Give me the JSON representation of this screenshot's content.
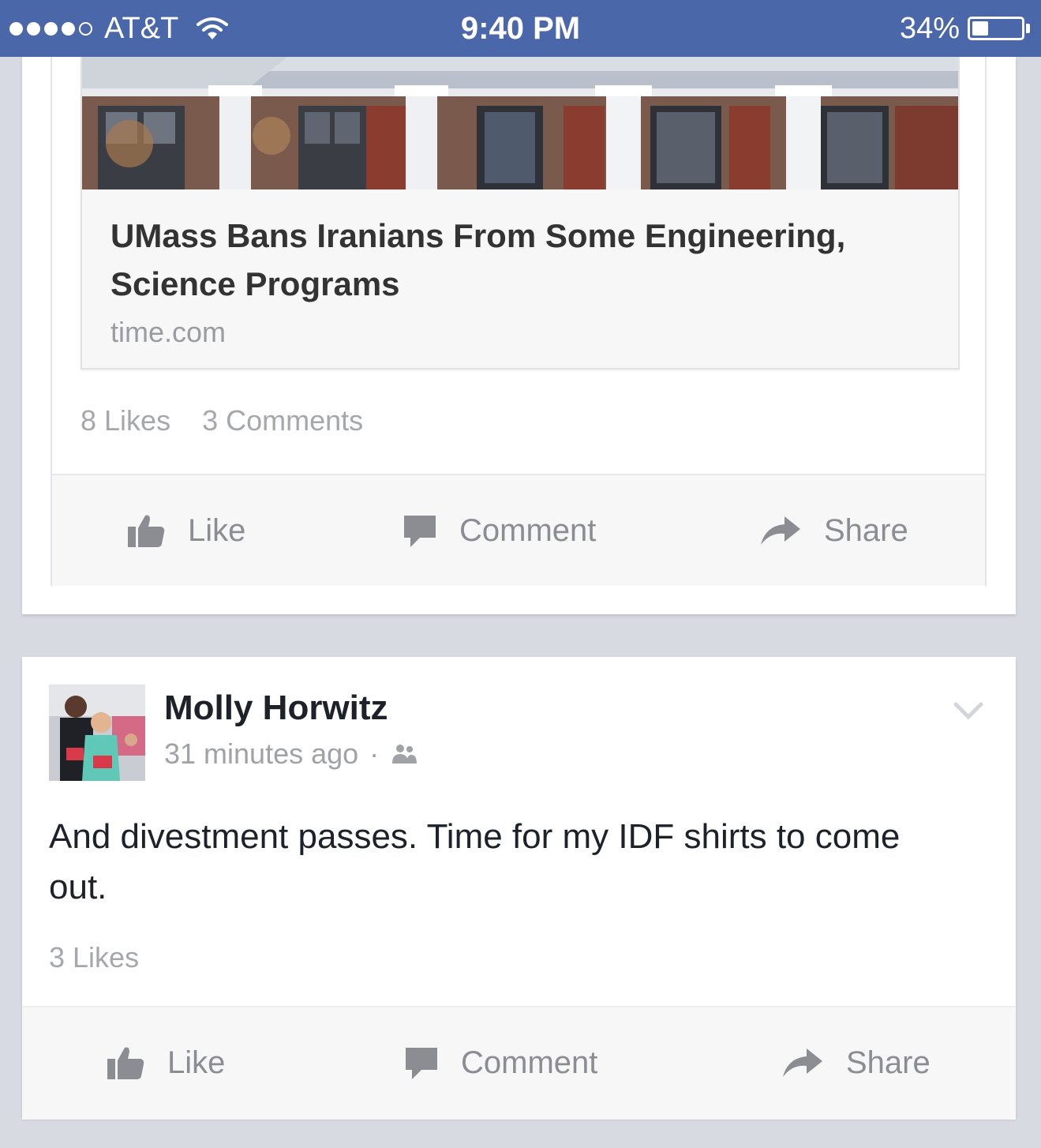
{
  "status_bar": {
    "carrier": "AT&T",
    "time": "9:40 PM",
    "battery_percent": "34%",
    "battery_level": 0.34,
    "signal_bars_filled": 4,
    "signal_bars_total": 5
  },
  "post1": {
    "link": {
      "title": "UMass Bans Iranians From Some Engineering, Science Programs",
      "domain": "time.com"
    },
    "likes": "8 Likes",
    "comments": "3 Comments",
    "actions": {
      "like": "Like",
      "comment": "Comment",
      "share": "Share"
    }
  },
  "post2": {
    "author": "Molly Horwitz",
    "timestamp": "31 minutes ago",
    "separator": "·",
    "audience_icon": "friends-icon",
    "text": "And divestment passes. Time for my IDF shirts to come out.",
    "likes": "3 Likes",
    "actions": {
      "like": "Like",
      "comment": "Comment",
      "share": "Share"
    }
  },
  "colors": {
    "status_bar": "#4a67a9",
    "feed_background": "#d8dae1",
    "action_text": "#8b8d93"
  }
}
